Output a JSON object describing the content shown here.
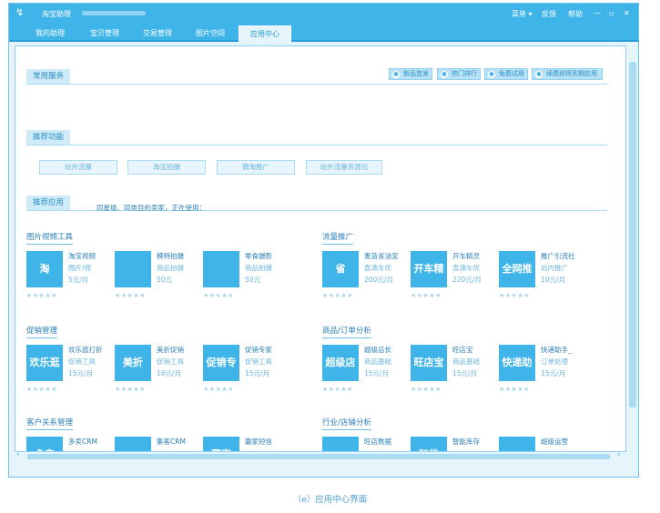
{
  "window": {
    "title": "淘宝助理",
    "logo": "↯"
  },
  "titlebar_right": {
    "menu": "菜单 ▾",
    "feedback": "反馈",
    "help": "帮助",
    "minimize": "—",
    "maximize": "▫",
    "close": "✕"
  },
  "tabs": [
    "我的助理",
    "宝贝管理",
    "交易管理",
    "图片空间",
    "应用中心"
  ],
  "active_tab": 4,
  "common_services": {
    "title": "常用服务",
    "buttons": [
      {
        "icon": "new-icon",
        "glyph": "●",
        "label": "新品首发"
      },
      {
        "icon": "hot-icon",
        "glyph": "●",
        "label": "热门排行"
      },
      {
        "icon": "free-icon",
        "glyph": "●",
        "label": "免费试用"
      },
      {
        "icon": "renew-icon",
        "glyph": "●",
        "label": "续费即将到期应用"
      }
    ]
  },
  "recommended_features": {
    "title": "推荐功能",
    "items": [
      "站外流量",
      "淘宝拍摄",
      "微淘推广",
      "站外流量资源包"
    ]
  },
  "recommended_apps": {
    "title": "推荐应用",
    "note": "同星级、同类目的卖家，正在使用："
  },
  "categories": [
    {
      "title": "图片视频工具",
      "apps": [
        {
          "tile": "淘",
          "name": "淘宝视频",
          "desc": "图片/视",
          "price": "5元/月",
          "stars": "★★★★★"
        },
        {
          "tile": "",
          "name": "模特拍摄",
          "desc": "商品拍摄",
          "price": "50元",
          "stars": "★★★★★"
        },
        {
          "tile": "",
          "name": "零食摄影",
          "desc": "商品拍摄",
          "price": "50元",
          "stars": "★★★★★"
        }
      ]
    },
    {
      "title": "流量推广",
      "apps": [
        {
          "tile": "省",
          "name": "麦苗省油宝",
          "desc": "直通车优",
          "price": "200元/月",
          "stars": "★★★★★"
        },
        {
          "tile": "开车精灵",
          "name": "开车精灵",
          "desc": "直通车优",
          "price": "220元/月",
          "stars": "★★★★★"
        },
        {
          "tile": "全网推广",
          "name": "推广引流社",
          "desc": "站内推广",
          "price": "10元/月",
          "stars": "★★★★★"
        }
      ]
    },
    {
      "title": "促销管理",
      "apps": [
        {
          "tile": "欢乐逛",
          "name": "欢乐逛打折",
          "desc": "促销工具",
          "price": "15元/月",
          "stars": "★★★★★"
        },
        {
          "tile": "美折",
          "name": "美折促销",
          "desc": "促销工具",
          "price": "18元/月",
          "stars": "★★★★★"
        },
        {
          "tile": "促销专家",
          "name": "促销专家",
          "desc": "促销工具",
          "price": "15元/月",
          "stars": "★★★★★"
        }
      ]
    },
    {
      "title": "商品/订单分析",
      "apps": [
        {
          "tile": "超级店长",
          "name": "超级店长",
          "desc": "商品基础",
          "price": "15元/月",
          "stars": "★★★★★"
        },
        {
          "tile": "旺店宝",
          "name": "旺店宝",
          "desc": "商品基础",
          "price": "15元/月",
          "stars": "★★★★★"
        },
        {
          "tile": "快递助手",
          "name": "快递助手_",
          "desc": "订单处理",
          "price": "15元/月",
          "stars": "★★★★★"
        }
      ]
    },
    {
      "title": "客户关系管理",
      "apps": [
        {
          "tile": "多卖",
          "name": "多卖CRM",
          "desc": "",
          "price": "",
          "stars": ""
        },
        {
          "tile": "",
          "name": "集客CRM",
          "desc": "",
          "price": "",
          "stars": ""
        },
        {
          "tile": "赢家",
          "name": "赢家短信",
          "desc": "",
          "price": "",
          "stars": ""
        }
      ]
    },
    {
      "title": "行业/店铺分析",
      "apps": [
        {
          "tile": "",
          "name": "旺店数据",
          "desc": "",
          "price": "",
          "stars": ""
        },
        {
          "tile": "智能",
          "name": "智能库存",
          "desc": "",
          "price": "",
          "stars": ""
        },
        {
          "tile": "",
          "name": "超级运营",
          "desc": "",
          "price": "",
          "stars": ""
        }
      ]
    }
  ],
  "scroll": {
    "left_arrow": "‹",
    "right_arrow": "›"
  },
  "caption": "（e）应用中心界面"
}
